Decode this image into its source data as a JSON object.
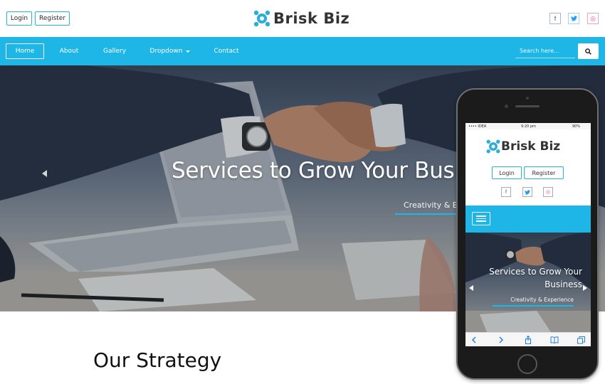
{
  "header": {
    "login_label": "Login",
    "register_label": "Register",
    "logo_text": "Brisk Biz",
    "social": {
      "facebook": "f",
      "twitter": "t",
      "dribbble": "◎"
    }
  },
  "nav": {
    "items": [
      {
        "label": "Home",
        "active": true
      },
      {
        "label": "About"
      },
      {
        "label": "Gallery"
      },
      {
        "label": "Dropdown"
      },
      {
        "label": "Contact"
      }
    ],
    "search_placeholder": "Search here...",
    "search_icon": "search-icon"
  },
  "hero": {
    "title": "Services to Grow Your Business",
    "subtitle": "Creativity & Experience"
  },
  "strategy": {
    "title": "Our Strategy"
  },
  "mobile": {
    "status_carrier": "•••• IDEA",
    "status_time": "9:20 pm",
    "status_battery": "90%",
    "logo_text": "Brisk Biz",
    "login_label": "Login",
    "register_label": "Register",
    "hero_title_line1": "Services to Grow Your",
    "hero_title_line2": "Business",
    "hero_subtitle": "Creativity & Experience"
  },
  "colors": {
    "accent": "#1db6e6",
    "logo_mark": "#2aaed8"
  }
}
